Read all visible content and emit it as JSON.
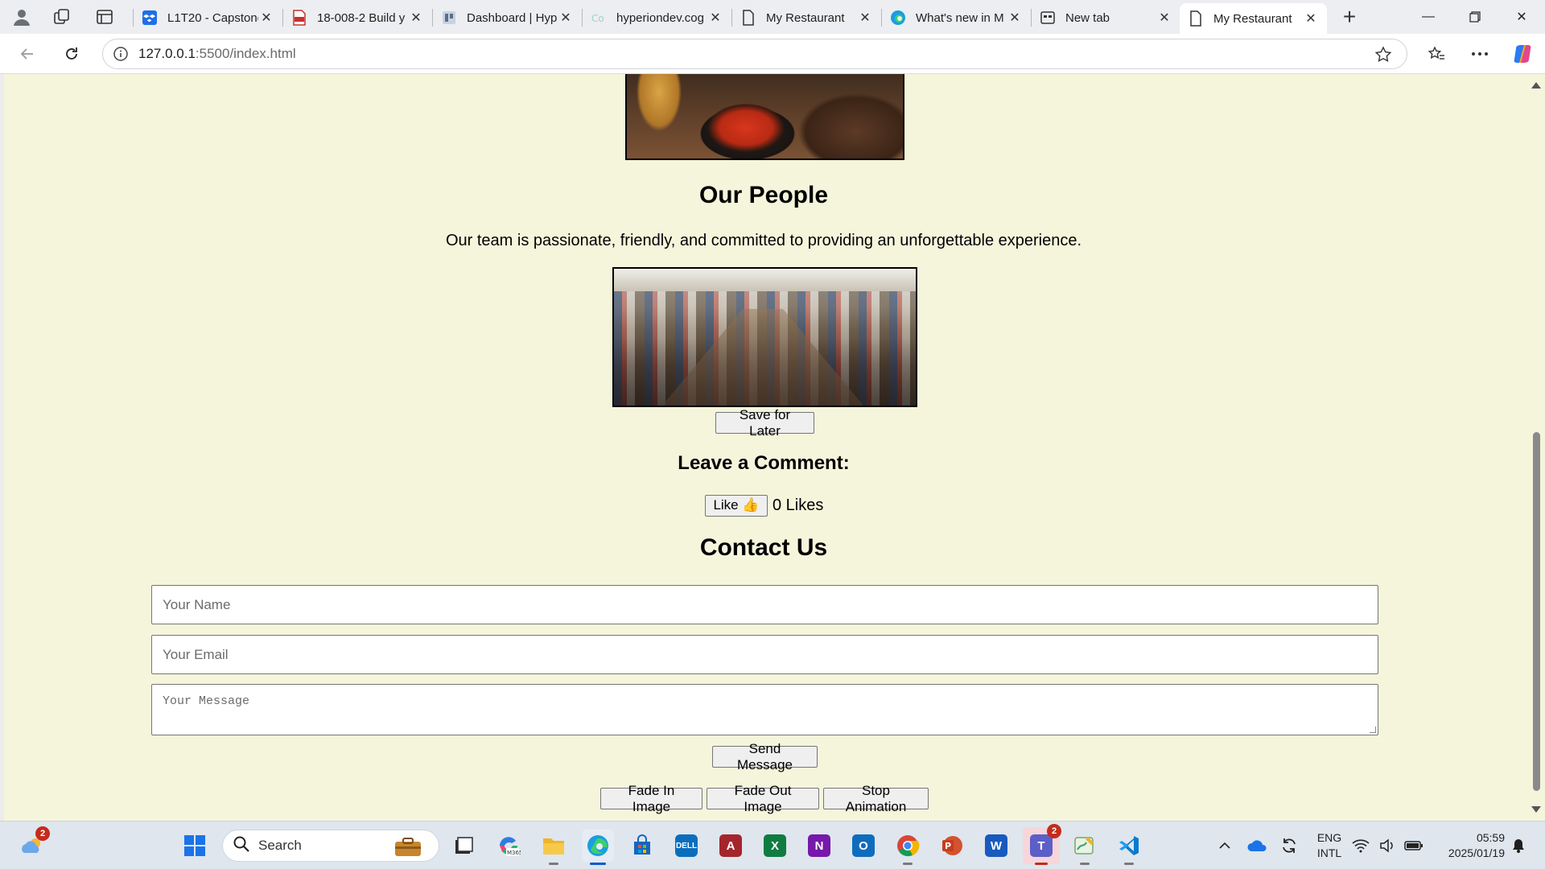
{
  "browser": {
    "tabs": [
      {
        "title": "L1T20 - Capstone",
        "icon": "dropbox-icon",
        "active": false
      },
      {
        "title": "18-008-2 Build y",
        "icon": "pdf-icon",
        "active": false
      },
      {
        "title": "Dashboard | Hyp",
        "icon": "dashboard-icon",
        "active": false
      },
      {
        "title": "hyperiondev.cog",
        "icon": "cogrammar-icon",
        "active": false
      },
      {
        "title": "My Restaurant",
        "icon": "page-icon",
        "active": false
      },
      {
        "title": "What's new in M",
        "icon": "edge-icon",
        "active": false
      },
      {
        "title": "New tab",
        "icon": "newtab-icon",
        "active": false
      },
      {
        "title": "My Restaurant",
        "icon": "page-icon",
        "active": true
      }
    ],
    "url_host": "127.0.0.1",
    "url_rest": ":5500/index.html"
  },
  "page": {
    "people_heading": "Our People",
    "people_text": "Our team is passionate, friendly, and committed to providing an unforgettable experience.",
    "save_button": "Save for Later",
    "comment_heading": "Leave a Comment:",
    "like_button": "Like 👍",
    "likes_count": "0 Likes",
    "contact_heading": "Contact Us",
    "name_placeholder": "Your Name",
    "email_placeholder": "Your Email",
    "message_placeholder": "Your Message",
    "send_button": "Send Message",
    "fade_in_button": "Fade In Image",
    "fade_out_button": "Fade Out Image",
    "stop_button": "Stop Animation"
  },
  "taskbar": {
    "search_label": "Search",
    "weather_badge": "2",
    "teams_badge": "2",
    "lang_line1": "ENG",
    "lang_line2": "INTL",
    "time": "05:59",
    "date": "2025/01/19"
  },
  "colors": {
    "page_background": "#f5f5dc",
    "active_tab": "#ffffff",
    "taskbar": "#dfe6ee"
  }
}
